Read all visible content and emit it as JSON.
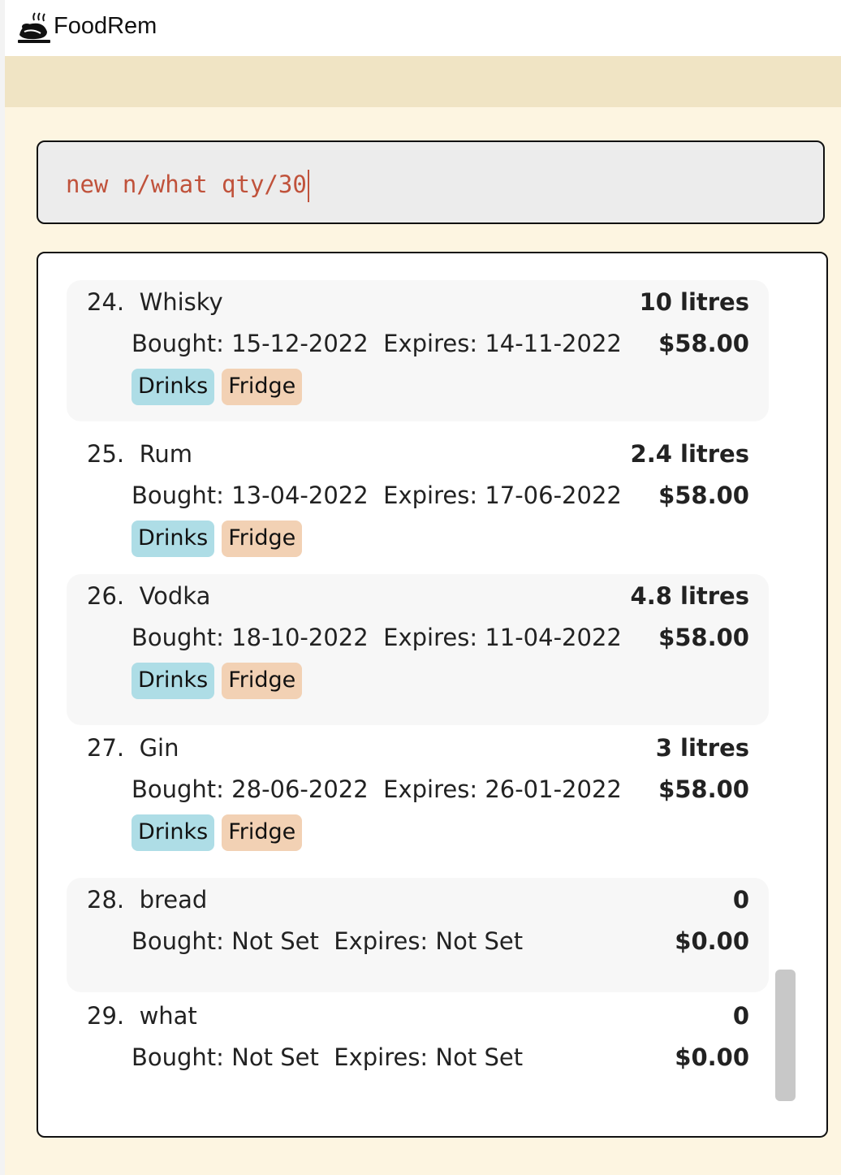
{
  "window": {
    "title": "FoodRem",
    "icon": "roast-chicken-icon"
  },
  "command": {
    "value": "new n/what qty/30"
  },
  "colors": {
    "menubar": "#f0e4c4",
    "background": "#fdf5e1",
    "command_text": "#c0523b",
    "tag_drinks": "#aedde6",
    "tag_fridge": "#f2d1b4"
  },
  "items": [
    {
      "index": "24.",
      "name": "Whisky",
      "quantity": "10 litres",
      "bought": "Bought: 15-12-2022",
      "expires": "Expires: 14-11-2022",
      "price": "$58.00",
      "tags": [
        "Drinks",
        "Fridge"
      ]
    },
    {
      "index": "25.",
      "name": "Rum",
      "quantity": "2.4 litres",
      "bought": "Bought: 13-04-2022",
      "expires": "Expires: 17-06-2022",
      "price": "$58.00",
      "tags": [
        "Drinks",
        "Fridge"
      ]
    },
    {
      "index": "26.",
      "name": "Vodka",
      "quantity": "4.8 litres",
      "bought": "Bought: 18-10-2022",
      "expires": "Expires: 11-04-2022",
      "price": "$58.00",
      "tags": [
        "Drinks",
        "Fridge"
      ]
    },
    {
      "index": "27.",
      "name": "Gin",
      "quantity": "3 litres",
      "bought": "Bought: 28-06-2022",
      "expires": "Expires: 26-01-2022",
      "price": "$58.00",
      "tags": [
        "Drinks",
        "Fridge"
      ]
    },
    {
      "index": "28.",
      "name": "bread",
      "quantity": "0",
      "bought": "Bought: Not Set",
      "expires": "Expires: Not Set",
      "price": "$0.00",
      "tags": []
    },
    {
      "index": "29.",
      "name": "what",
      "quantity": "0",
      "bought": "Bought: Not Set",
      "expires": "Expires: Not Set",
      "price": "$0.00",
      "tags": []
    }
  ]
}
